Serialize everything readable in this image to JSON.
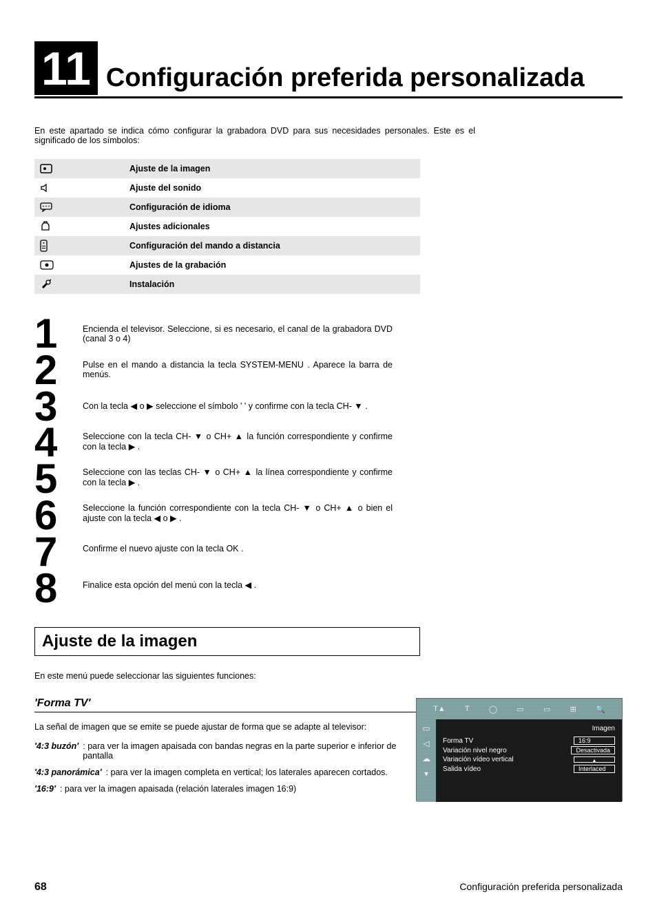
{
  "chapter": {
    "number": "11",
    "title": "Configuración preferida personalizada"
  },
  "intro": "En este apartado se indica cómo configurar la grabadora DVD para sus necesidades personales. Este es el significado de los símbolos:",
  "symbols": [
    {
      "label": "Ajuste de la imagen"
    },
    {
      "label": "Ajuste del sonido"
    },
    {
      "label": "Configuración de idioma"
    },
    {
      "label": "Ajustes adicionales"
    },
    {
      "label": "Configuración del mando a distancia"
    },
    {
      "label": "Ajustes de la grabación"
    },
    {
      "label": "Instalación"
    }
  ],
  "steps": [
    "Encienda el televisor. Seleccione, si es necesario, el canal de la grabadora DVD (canal 3 o 4)",
    "Pulse en el mando a distancia la tecla SYSTEM-MENU . Aparece la barra de menús.",
    "Con la tecla ◀ o ▶ seleccione el símbolo ' ' y confirme con la tecla CH- ▼ .",
    "Seleccione con la tecla CH- ▼ o CH+ ▲ la función correspondiente y confirme con la tecla ▶ .",
    "Seleccione con las teclas CH- ▼ o CH+ ▲ la línea correspondiente y confirme con la tecla ▶ .",
    "Seleccione la función correspondiente con la tecla CH- ▼ o CH+ ▲ o bien el ajuste con la tecla ◀ o ▶ .",
    "Confirme el nuevo ajuste con la tecla OK .",
    "Finalice esta opción del menú con la tecla ◀ ."
  ],
  "section": {
    "heading": "Ajuste de la imagen",
    "intro": "En este menú puede seleccionar las siguientes funciones:",
    "subheading": "'Forma TV'",
    "lead": "La señal de imagen que se emite se puede ajustar de forma que se adapte al televisor:",
    "options": [
      {
        "label": "'4:3 buzón'",
        "desc": ": para ver la imagen apaisada con bandas negras en la parte superior e inferior de pantalla"
      },
      {
        "label": "'4:3 panorámica'",
        "desc": ": para ver la imagen completa en vertical; los laterales aparecen cortados."
      },
      {
        "label": "'16:9'",
        "desc": " : para ver la imagen apaisada (relación laterales imagen 16:9)"
      }
    ]
  },
  "osd": {
    "title": "Imagen",
    "rows": [
      {
        "k": "Forma TV",
        "v": "16:9"
      },
      {
        "k": "Variación nivel negro",
        "v": "Desactivada"
      },
      {
        "k": "Variación vídeo vertical",
        "v": ""
      },
      {
        "k": "Salida vídeo",
        "v": "Interlaced"
      }
    ]
  },
  "footer": {
    "page": "68",
    "section": "Configuración preferida personalizada"
  }
}
